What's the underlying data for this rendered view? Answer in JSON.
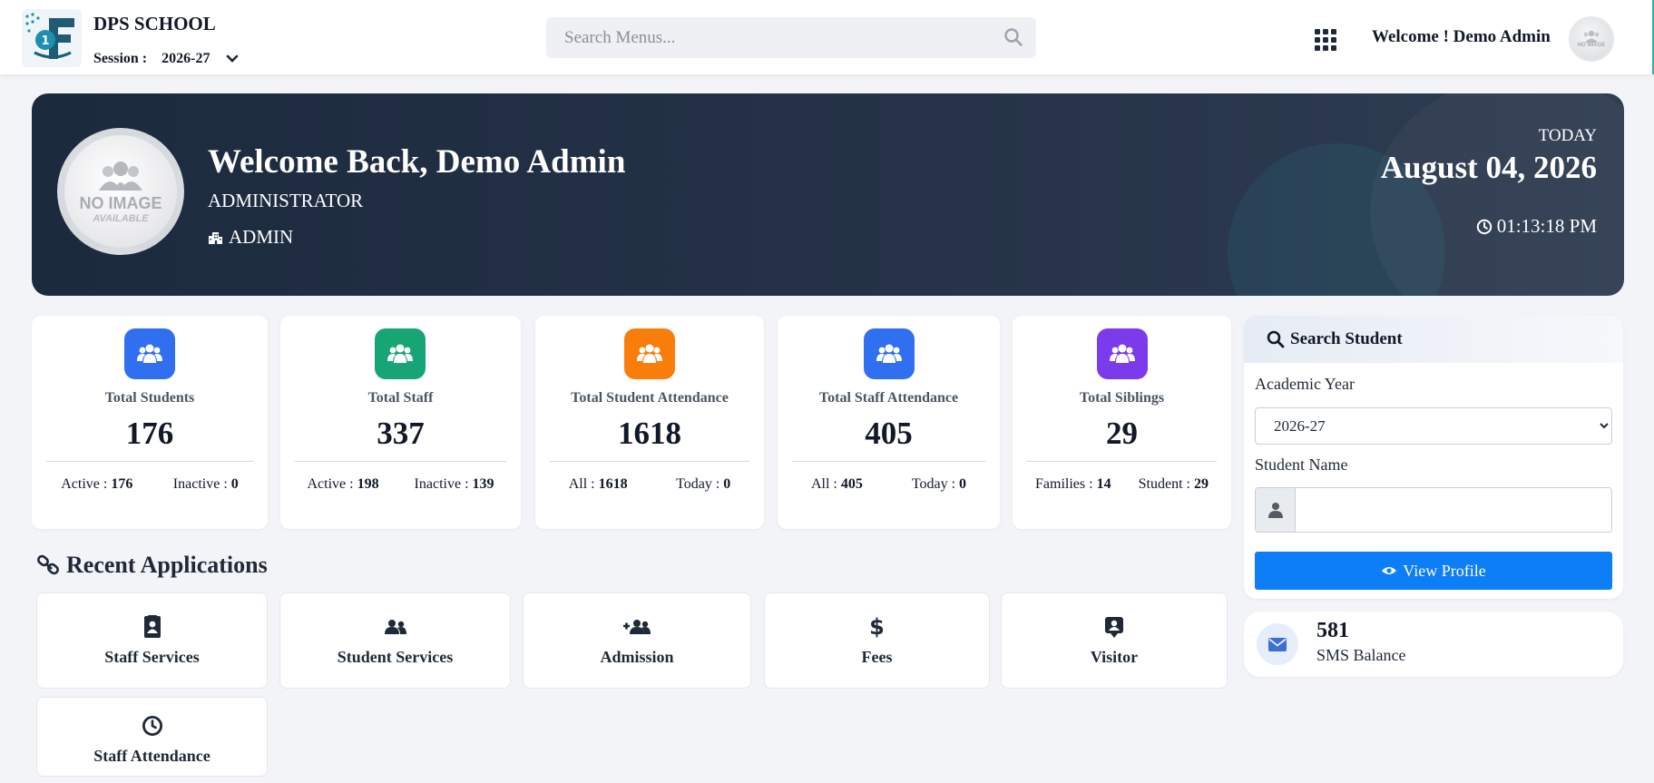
{
  "header": {
    "school_name": "DPS SCHOOL",
    "session_label": "Session :",
    "session_value": "2026-27",
    "search_placeholder": "Search Menus...",
    "welcome_text": "Welcome ! Demo Admin",
    "avatar_text": "NO IMAGE"
  },
  "hero": {
    "avatar_line1": "NO IMAGE",
    "avatar_line2": "AVAILABLE",
    "title": "Welcome Back, Demo Admin",
    "role": "ADMINISTRATOR",
    "department": "ADMIN",
    "today_label": "TODAY",
    "date": "August 04, 2026",
    "time": "01:13:18 PM"
  },
  "stats": [
    {
      "label": "Total Students",
      "value": "176",
      "sub1_label": "Active :",
      "sub1_value": "176",
      "sub2_label": "Inactive :",
      "sub2_value": "0",
      "color": "#2f6ff0"
    },
    {
      "label": "Total Staff",
      "value": "337",
      "sub1_label": "Active :",
      "sub1_value": "198",
      "sub2_label": "Inactive :",
      "sub2_value": "139",
      "color": "#17a673"
    },
    {
      "label": "Total Student Attendance",
      "value": "1618",
      "sub1_label": "All :",
      "sub1_value": "1618",
      "sub2_label": "Today :",
      "sub2_value": "0",
      "color": "#f97d0b"
    },
    {
      "label": "Total Staff Attendance",
      "value": "405",
      "sub1_label": "All :",
      "sub1_value": "405",
      "sub2_label": "Today :",
      "sub2_value": "0",
      "color": "#2f6ff0"
    },
    {
      "label": "Total Siblings",
      "value": "29",
      "sub1_label": "Families :",
      "sub1_value": "14",
      "sub2_label": "Student :",
      "sub2_value": "29",
      "color": "#7c3aed"
    }
  ],
  "search_student": {
    "title": "Search Student",
    "year_label": "Academic Year",
    "year_value": "2026-27",
    "name_label": "Student Name",
    "name_value": "",
    "button_label": "View Profile"
  },
  "sms": {
    "value": "581",
    "label": "SMS Balance"
  },
  "recent": {
    "title": "Recent Applications",
    "apps": [
      {
        "label": "Staff Services",
        "icon": "staff-id-icon"
      },
      {
        "label": "Student Services",
        "icon": "users-icon"
      },
      {
        "label": "Admission",
        "icon": "user-plus-icon"
      },
      {
        "label": "Fees",
        "icon": "dollar-icon"
      },
      {
        "label": "Visitor",
        "icon": "visitor-badge-icon"
      },
      {
        "label": "Staff Attendance",
        "icon": "clock-icon"
      }
    ]
  }
}
